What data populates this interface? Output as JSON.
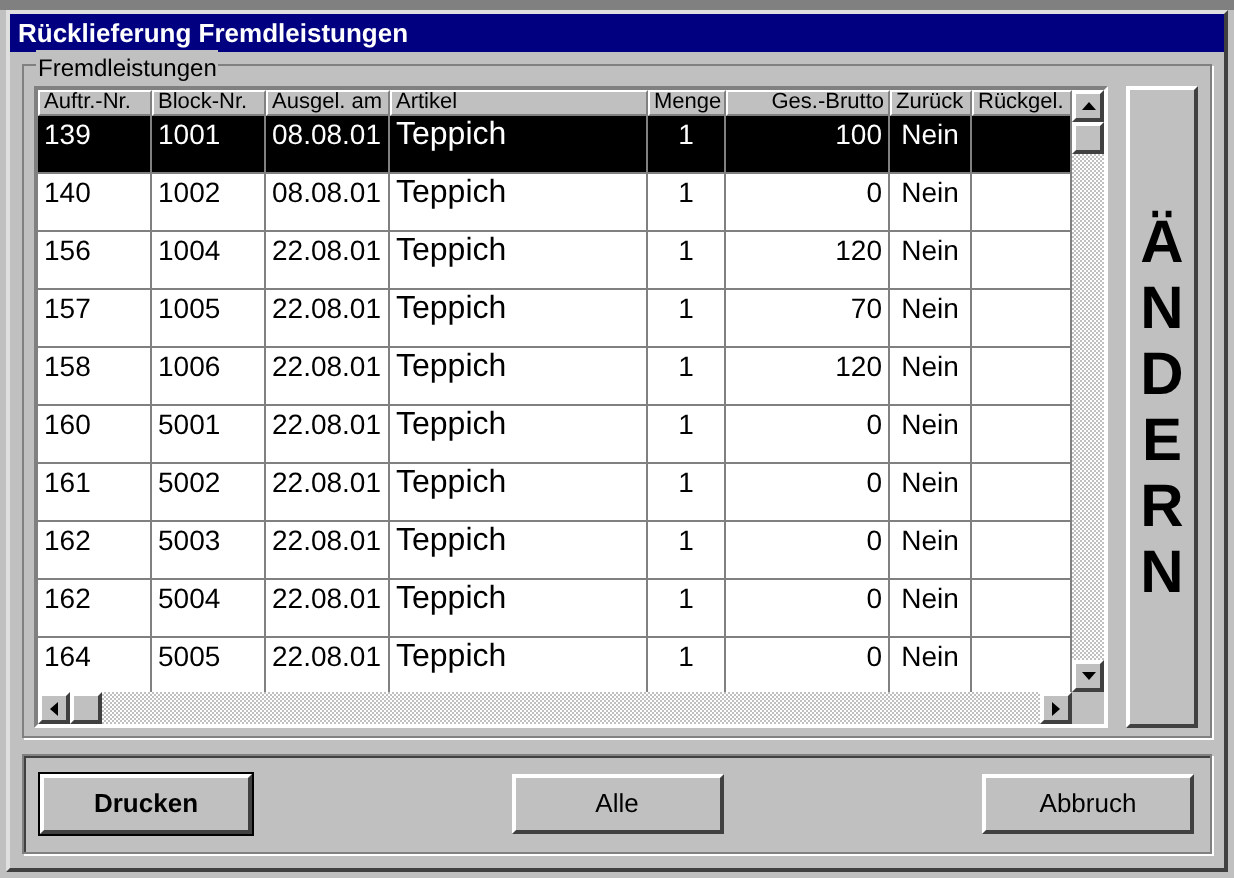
{
  "window": {
    "title": "Rücklieferung Fremdleistungen"
  },
  "group": {
    "title": "Fremdleistungen"
  },
  "table": {
    "columns": [
      "Auftr.-Nr.",
      "Block-Nr.",
      "Ausgel. am",
      "Artikel",
      "Menge",
      "Ges.-Brutto",
      "Zurück",
      "Rückgel."
    ],
    "rows": [
      {
        "cells": [
          "139",
          "1001",
          "08.08.01",
          "Teppich",
          "1",
          "100",
          "Nein",
          ""
        ],
        "selected": true
      },
      {
        "cells": [
          "140",
          "1002",
          "08.08.01",
          "Teppich",
          "1",
          "0",
          "Nein",
          ""
        ],
        "selected": false
      },
      {
        "cells": [
          "156",
          "1004",
          "22.08.01",
          "Teppich",
          "1",
          "120",
          "Nein",
          ""
        ],
        "selected": false
      },
      {
        "cells": [
          "157",
          "1005",
          "22.08.01",
          "Teppich",
          "1",
          "70",
          "Nein",
          ""
        ],
        "selected": false
      },
      {
        "cells": [
          "158",
          "1006",
          "22.08.01",
          "Teppich",
          "1",
          "120",
          "Nein",
          ""
        ],
        "selected": false
      },
      {
        "cells": [
          "160",
          "5001",
          "22.08.01",
          "Teppich",
          "1",
          "0",
          "Nein",
          ""
        ],
        "selected": false
      },
      {
        "cells": [
          "161",
          "5002",
          "22.08.01",
          "Teppich",
          "1",
          "0",
          "Nein",
          ""
        ],
        "selected": false
      },
      {
        "cells": [
          "162",
          "5003",
          "22.08.01",
          "Teppich",
          "1",
          "0",
          "Nein",
          ""
        ],
        "selected": false
      },
      {
        "cells": [
          "162",
          "5004",
          "22.08.01",
          "Teppich",
          "1",
          "0",
          "Nein",
          ""
        ],
        "selected": false
      },
      {
        "cells": [
          "164",
          "5005",
          "22.08.01",
          "Teppich",
          "1",
          "0",
          "Nein",
          ""
        ],
        "selected": false
      }
    ]
  },
  "side_button": {
    "label": "ÄNDERN"
  },
  "buttons": [
    {
      "label": "Drucken",
      "default": true
    },
    {
      "label": "Alle",
      "default": false
    },
    {
      "label": "Abbruch",
      "default": false
    }
  ]
}
